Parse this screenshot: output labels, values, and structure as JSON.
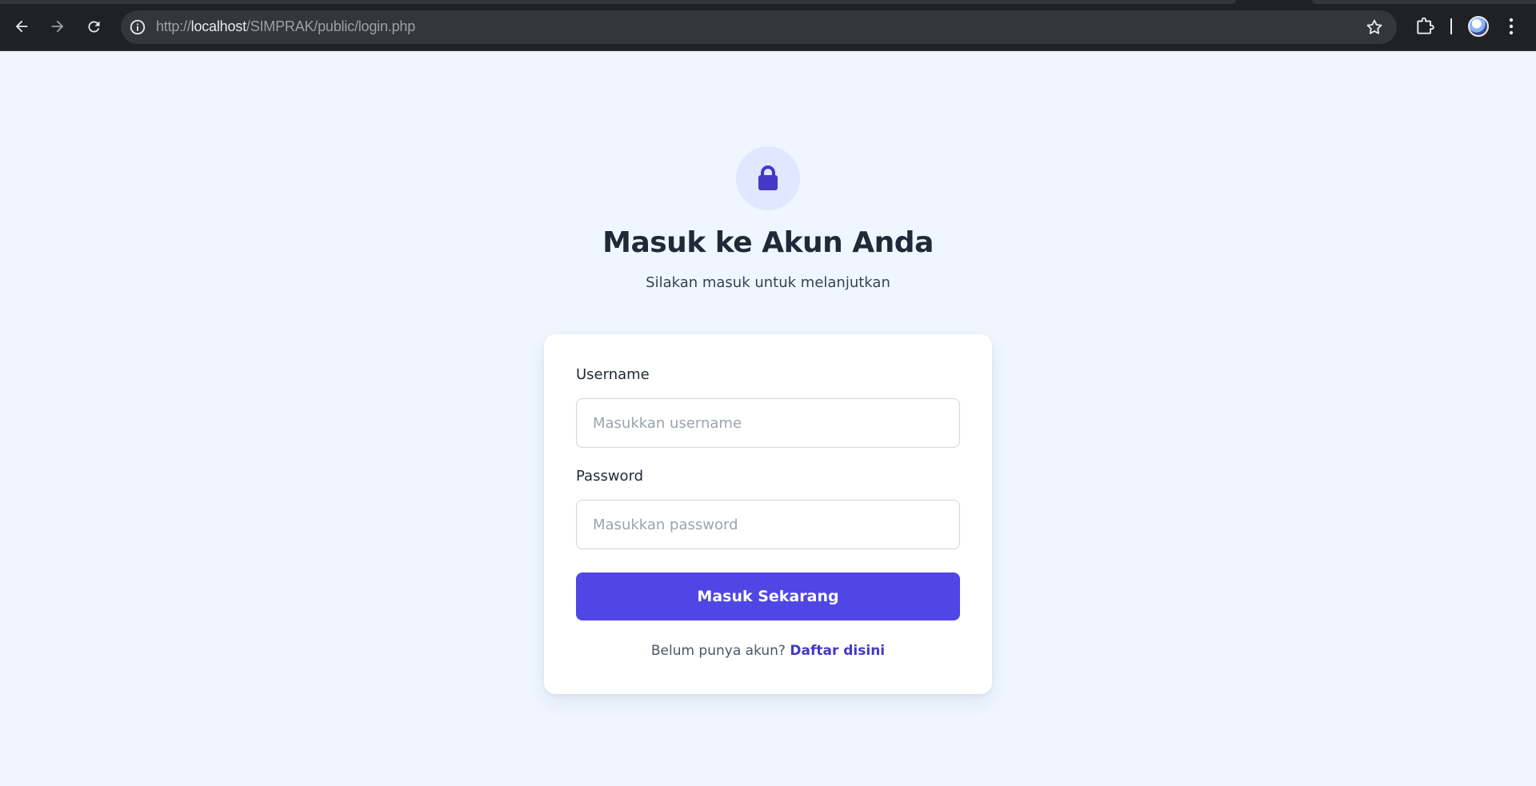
{
  "browser": {
    "url_prefix": "http://",
    "url_host": "localhost",
    "url_path": "/SIMPRAK/public/login.php"
  },
  "login": {
    "title": "Masuk ke Akun Anda",
    "subtitle": "Silakan masuk untuk melanjutkan",
    "username_label": "Username",
    "username_placeholder": "Masukkan username",
    "username_value": "",
    "password_label": "Password",
    "password_placeholder": "Masukkan password",
    "password_value": "",
    "submit_label": "Masuk Sekarang",
    "register_prompt": "Belum punya akun?",
    "register_link": "Daftar disini"
  },
  "colors": {
    "page_background": "#eff6ff",
    "accent": "#4f46e5",
    "link": "#4338ca",
    "lock_circle": "#e0e7ff",
    "lock_icon": "#4338ca"
  },
  "icons": {
    "back": "arrow-left-icon",
    "forward": "arrow-right-icon",
    "reload": "reload-icon",
    "site_info": "info-icon",
    "bookmark": "star-icon",
    "extensions": "puzzle-icon",
    "profile": "avatar",
    "menu": "kebab-menu-icon",
    "header": "lock-icon"
  }
}
